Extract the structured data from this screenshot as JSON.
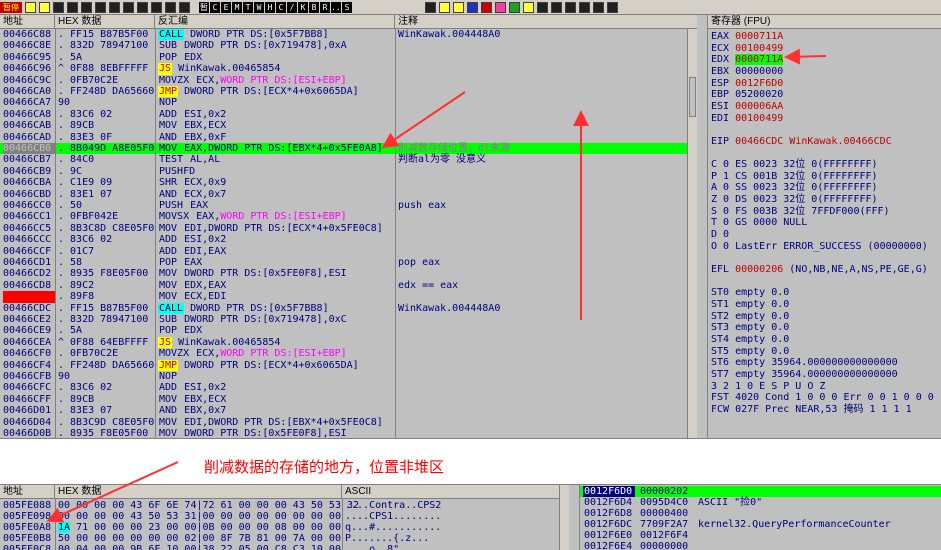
{
  "toolbar": {
    "buttons": [
      "暂停",
      "C",
      "E",
      "M",
      "T",
      "W",
      "H",
      "C",
      "/",
      "K",
      "B",
      "R",
      "...",
      "S"
    ],
    "left_mark": "暂停"
  },
  "disasm": {
    "headers": {
      "addr": "地址",
      "hex": "HEX 数据",
      "asm": "反汇编",
      "cmt": "注释"
    },
    "rows": [
      {
        "addr": "00466C88",
        "hex": ". FF15 B87B5F00",
        "mn": "CALL",
        "mnc": "call",
        "ops": "DWORD PTR DS:[0x5F7BB8]",
        "cmt": "WinKawak.004448A0"
      },
      {
        "addr": "00466C8E",
        "hex": ". 832D 78947100",
        "mn": "SUB",
        "mnc": "",
        "ops": "DWORD PTR DS:[0x719478],0xA",
        "cmt": ""
      },
      {
        "addr": "00466C95",
        "hex": ". 5A",
        "mn": "POP",
        "mnc": "",
        "ops": "EDX",
        "cmt": ""
      },
      {
        "addr": "00466C96",
        "hex": "^ 0F88 8EBFFFFF",
        "mn": "JS",
        "mnc": "js",
        "ops": "WinKawak.00465854",
        "cmt": ""
      },
      {
        "addr": "00466C9C",
        "hex": ". 0FB70C2E",
        "mn": "MOVZX",
        "mnc": "",
        "ops": "ECX,",
        "mem": "WORD PTR DS:[ESI+EBP]",
        "cmt": ""
      },
      {
        "addr": "00466CA0",
        "hex": ". FF248D DA656600",
        "mn": "JMP",
        "mnc": "jmp",
        "ops": "DWORD PTR DS:[ECX*4+0x6065DA]",
        "cmt": ""
      },
      {
        "addr": "00466CA7",
        "hex": "  90",
        "mn": "NOP",
        "mnc": "",
        "ops": "",
        "cmt": ""
      },
      {
        "addr": "00466CA8",
        "hex": ". 83C6 02",
        "mn": "ADD",
        "mnc": "",
        "ops": "ESI,0x2",
        "cmt": ""
      },
      {
        "addr": "00466CAB",
        "hex": ". 89CB",
        "mn": "MOV",
        "mnc": "",
        "ops": "EBX,ECX",
        "cmt": ""
      },
      {
        "addr": "00466CAD",
        "hex": ". 83E3 0F",
        "mn": "AND",
        "mnc": "",
        "ops": "EBX,0xF",
        "cmt": ""
      },
      {
        "addr": "00466CB0",
        "hex": ". 8B049D A8E05F00",
        "mn": "MOV",
        "mnc": "",
        "ops": "EAX,DWORD PTR DS:[EBX*4+0x5FE0A8]",
        "cmt": "削减数存储位置，dl未源",
        "hl": true
      },
      {
        "addr": "00466CB7",
        "hex": ". 84C0",
        "mn": "TEST",
        "mnc": "",
        "ops": "AL,AL",
        "cmt": "判断al为零 没意义"
      },
      {
        "addr": "00466CB9",
        "hex": ". 9C",
        "mn": "PUSHFD",
        "mnc": "",
        "ops": "",
        "cmt": ""
      },
      {
        "addr": "00466CBA",
        "hex": ". C1E9 09",
        "mn": "SHR",
        "mnc": "",
        "ops": "ECX,0x9",
        "cmt": ""
      },
      {
        "addr": "00466CBD",
        "hex": ". 83E1 07",
        "mn": "AND",
        "mnc": "",
        "ops": "ECX,0x7",
        "cmt": ""
      },
      {
        "addr": "00466CC0",
        "hex": ". 50",
        "mn": "PUSH",
        "mnc": "",
        "ops": "EAX",
        "cmt": "push eax"
      },
      {
        "addr": "00466CC1",
        "hex": ". 0FBF042E",
        "mn": "MOVSX",
        "mnc": "",
        "ops": "EAX,",
        "mem": "WORD PTR DS:[ESI+EBP]",
        "cmt": ""
      },
      {
        "addr": "00466CC5",
        "hex": ". 8B3C8D C8E05F00",
        "mn": "MOV",
        "mnc": "",
        "ops": "EDI,DWORD PTR DS:[ECX*4+0x5FE0C8]",
        "cmt": ""
      },
      {
        "addr": "00466CCC",
        "hex": ". 83C6 02",
        "mn": "ADD",
        "mnc": "",
        "ops": "ESI,0x2",
        "cmt": ""
      },
      {
        "addr": "00466CCF",
        "hex": ". 01C7",
        "mn": "ADD",
        "mnc": "",
        "ops": "EDI,EAX",
        "cmt": ""
      },
      {
        "addr": "00466CD1",
        "hex": ". 58",
        "mn": "POP",
        "mnc": "",
        "ops": "EAX",
        "cmt": "pop eax"
      },
      {
        "addr": "00466CD2",
        "hex": ". 8935 F8E05F00",
        "mn": "MOV",
        "mnc": "",
        "ops": "DWORD PTR DS:[0x5FE0F8],ESI",
        "cmt": ""
      },
      {
        "addr": "00466CD8",
        "hex": ". 89C2",
        "mn": "MOV",
        "mnc": "",
        "ops": "EDX,EAX",
        "cmt": "edx == eax"
      },
      {
        "addr": "00466CDA",
        "hex": ". 89F8",
        "mn": "MOV",
        "mnc": "",
        "ops": "ECX,EDI",
        "cmt": "",
        "bp": true
      },
      {
        "addr": "00466CDC",
        "hex": ". FF15 B87B5F00",
        "mn": "CALL",
        "mnc": "call",
        "ops": "DWORD PTR DS:[0x5F7BB8]",
        "cmt": "WinKawak.004448A0"
      },
      {
        "addr": "00466CE2",
        "hex": ". 832D 78947100",
        "mn": "SUB",
        "mnc": "",
        "ops": "DWORD PTR DS:[0x719478],0xC",
        "cmt": ""
      },
      {
        "addr": "00466CE9",
        "hex": ". 5A",
        "mn": "POP",
        "mnc": "",
        "ops": "EDX",
        "cmt": ""
      },
      {
        "addr": "00466CEA",
        "hex": "^ 0F88 64EBFFFF",
        "mn": "JS",
        "mnc": "js",
        "ops": "WinKawak.00465854",
        "cmt": ""
      },
      {
        "addr": "00466CF0",
        "hex": ". 0FB70C2E",
        "mn": "MOVZX",
        "mnc": "",
        "ops": "ECX,",
        "mem": "WORD PTR DS:[ESI+EBP]",
        "cmt": ""
      },
      {
        "addr": "00466CF4",
        "hex": ". FF248D DA656600",
        "mn": "JMP",
        "mnc": "jmp",
        "ops": "DWORD PTR DS:[ECX*4+0x6065DA]",
        "cmt": ""
      },
      {
        "addr": "00466CFB",
        "hex": "  90",
        "mn": "NOP",
        "mnc": "",
        "ops": "",
        "cmt": ""
      },
      {
        "addr": "00466CFC",
        "hex": ". 83C6 02",
        "mn": "ADD",
        "mnc": "",
        "ops": "ESI,0x2",
        "cmt": ""
      },
      {
        "addr": "00466CFF",
        "hex": ". 89CB",
        "mn": "MOV",
        "mnc": "",
        "ops": "EBX,ECX",
        "cmt": ""
      },
      {
        "addr": "00466D01",
        "hex": ". 83E3 07",
        "mn": "AND",
        "mnc": "",
        "ops": "EBX,0x7",
        "cmt": ""
      },
      {
        "addr": "00466D04",
        "hex": ". 8B3C9D C8E05F00",
        "mn": "MOV",
        "mnc": "",
        "ops": "EDI,DWORD PTR DS:[EBX*4+0x5FE0C8]",
        "cmt": ""
      },
      {
        "addr": "00466D0B",
        "hex": ". 8935 F8E05F00",
        "mn": "MOV",
        "mnc": "",
        "ops": "DWORD PTR DS:[0x5FE0F8],ESI",
        "cmt": ""
      }
    ]
  },
  "registers": {
    "header": "寄存器 (FPU)",
    "lines": [
      {
        "text": "EAX ",
        "val": "0000711A",
        "style": "red"
      },
      {
        "text": "ECX ",
        "val": "00100499",
        "style": "red"
      },
      {
        "text": "EDX ",
        "val": "0000711A",
        "style": "hl"
      },
      {
        "text": "EBX ",
        "val": "00000000",
        "style": ""
      },
      {
        "text": "ESP ",
        "val": "0012F6D0",
        "style": "red"
      },
      {
        "text": "EBP ",
        "val": "05200020",
        "style": ""
      },
      {
        "text": "ESI ",
        "val": "000006AA",
        "style": "red"
      },
      {
        "text": "EDI ",
        "val": "00100499",
        "style": "red"
      },
      {
        "text": "",
        "val": "",
        "style": ""
      },
      {
        "text": "EIP ",
        "val": "00466CDC WinKawak.00466CDC",
        "style": "red"
      },
      {
        "text": "",
        "val": "",
        "style": ""
      },
      {
        "text": "C 0  ES 0023 32位 0(FFFFFFFF)",
        "val": "",
        "style": ""
      },
      {
        "text": "P 1  CS 001B 32位 0(FFFFFFFF)",
        "val": "",
        "style": ""
      },
      {
        "text": "A 0  SS 0023 32位 0(FFFFFFFF)",
        "val": "",
        "style": ""
      },
      {
        "text": "Z 0  DS 0023 32位 0(FFFFFFFF)",
        "val": "",
        "style": ""
      },
      {
        "text": "S 0  FS 003B 32位 7FFDF000(FFF)",
        "val": "",
        "style": ""
      },
      {
        "text": "T 0  GS 0000 NULL",
        "val": "",
        "style": ""
      },
      {
        "text": "D 0",
        "val": "",
        "style": ""
      },
      {
        "text": "O 0  LastErr ERROR_SUCCESS (00000000)",
        "val": "",
        "style": ""
      },
      {
        "text": "",
        "val": "",
        "style": ""
      },
      {
        "text": "EFL ",
        "val": "00000206",
        "style": "red",
        "tail": " (NO,NB,NE,A,NS,PE,GE,G)"
      },
      {
        "text": "",
        "val": "",
        "style": ""
      },
      {
        "text": "ST0 empty 0.0",
        "val": "",
        "style": ""
      },
      {
        "text": "ST1 empty 0.0",
        "val": "",
        "style": ""
      },
      {
        "text": "ST2 empty 0.0",
        "val": "",
        "style": ""
      },
      {
        "text": "ST3 empty 0.0",
        "val": "",
        "style": ""
      },
      {
        "text": "ST4 empty 0.0",
        "val": "",
        "style": ""
      },
      {
        "text": "ST5 empty 0.0",
        "val": "",
        "style": ""
      },
      {
        "text": "ST6 empty 35964.000000000000000",
        "val": "",
        "style": ""
      },
      {
        "text": "ST7 empty 35964.000000000000000",
        "val": "",
        "style": ""
      },
      {
        "text": "               3 2 1 0      E S P U O Z",
        "val": "",
        "style": ""
      },
      {
        "text": "FST 4020  Cond 1 0 0 0  Err 0 0 1 0 0 0",
        "val": "",
        "style": ""
      },
      {
        "text": "FCW 027F  Prec NEAR,53  掩码    1 1 1 1",
        "val": "",
        "style": ""
      }
    ]
  },
  "annotation": {
    "text": "削减数据的存储的地方，位置非堆区",
    "color": "#ff0000"
  },
  "dump": {
    "headers": {
      "addr": "地址",
      "hex": "HEX 数据",
      "ascii": "ASCII"
    },
    "rows": [
      {
        "addr": "005FE088",
        "first": "00",
        "hex": " 00 00 00 43 6F 6E 74|72 61 00 00 00 43 50 53 32",
        "ascii": "....Contra..CPS2"
      },
      {
        "addr": "005FE098",
        "first": "00",
        "hex": " 00 00 00 43 50 53 31|00 00 00 00 00 00 00 00",
        "ascii": "....CPS1........"
      },
      {
        "addr": "005FE0A8",
        "first": "1A",
        "hex": " 71 00 00 00 23 00 00|0B 00 00 00 08 00 00 00",
        "ascii": "q...#...........",
        "hl": true
      },
      {
        "addr": "005FE0B8",
        "first": "50",
        "hex": " 00 00 00 00 00 00 02|00 8F 7B 81 00 7A 00 00",
        "ascii": "P.......{.z..."
      },
      {
        "addr": "005FE0C8",
        "first": "00",
        "hex": " 04 00 00 9B 6F 10 00|38 22 05 00 C8 C3 10 00",
        "ascii": "....o..8\"....."
      }
    ]
  },
  "stack": {
    "rows": [
      {
        "addr": "0012F6D0",
        "val": "00000202",
        "cmt": "",
        "first": true
      },
      {
        "addr": "0012F6D4",
        "val": "0095D4C0",
        "cmt": "ASCII \"捡0\""
      },
      {
        "addr": "0012F6D8",
        "val": "00000400",
        "cmt": ""
      },
      {
        "addr": "0012F6DC",
        "val": "7709F2A7",
        "cmt": "kernel32.QueryPerformanceCounter"
      },
      {
        "addr": "0012F6E0",
        "val": "0012F6F4",
        "cmt": ""
      },
      {
        "addr": "0012F6E4",
        "val": "00000000",
        "cmt": ""
      }
    ]
  },
  "colors": {
    "highlight_green": "#00ff00",
    "breakpoint_red": "#ff0000",
    "arrow_red": "#ff3030"
  }
}
